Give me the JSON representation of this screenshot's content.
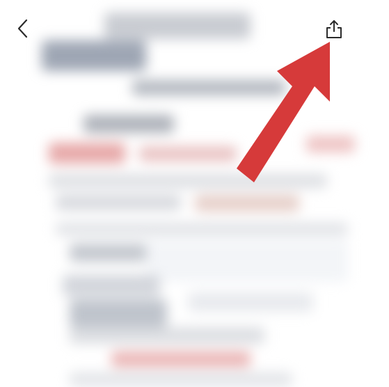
{
  "header": {
    "back_icon": "chevron-left-icon",
    "share_icon": "share-upload-icon"
  },
  "annotation": {
    "arrow_color": "#d63a3a",
    "points_to": "share-button"
  },
  "colors": {
    "background": "#ffffff",
    "icon": "#2b2b2b",
    "preview_text": "#b8bcc4",
    "preview_accent": "#e8a3a3"
  }
}
